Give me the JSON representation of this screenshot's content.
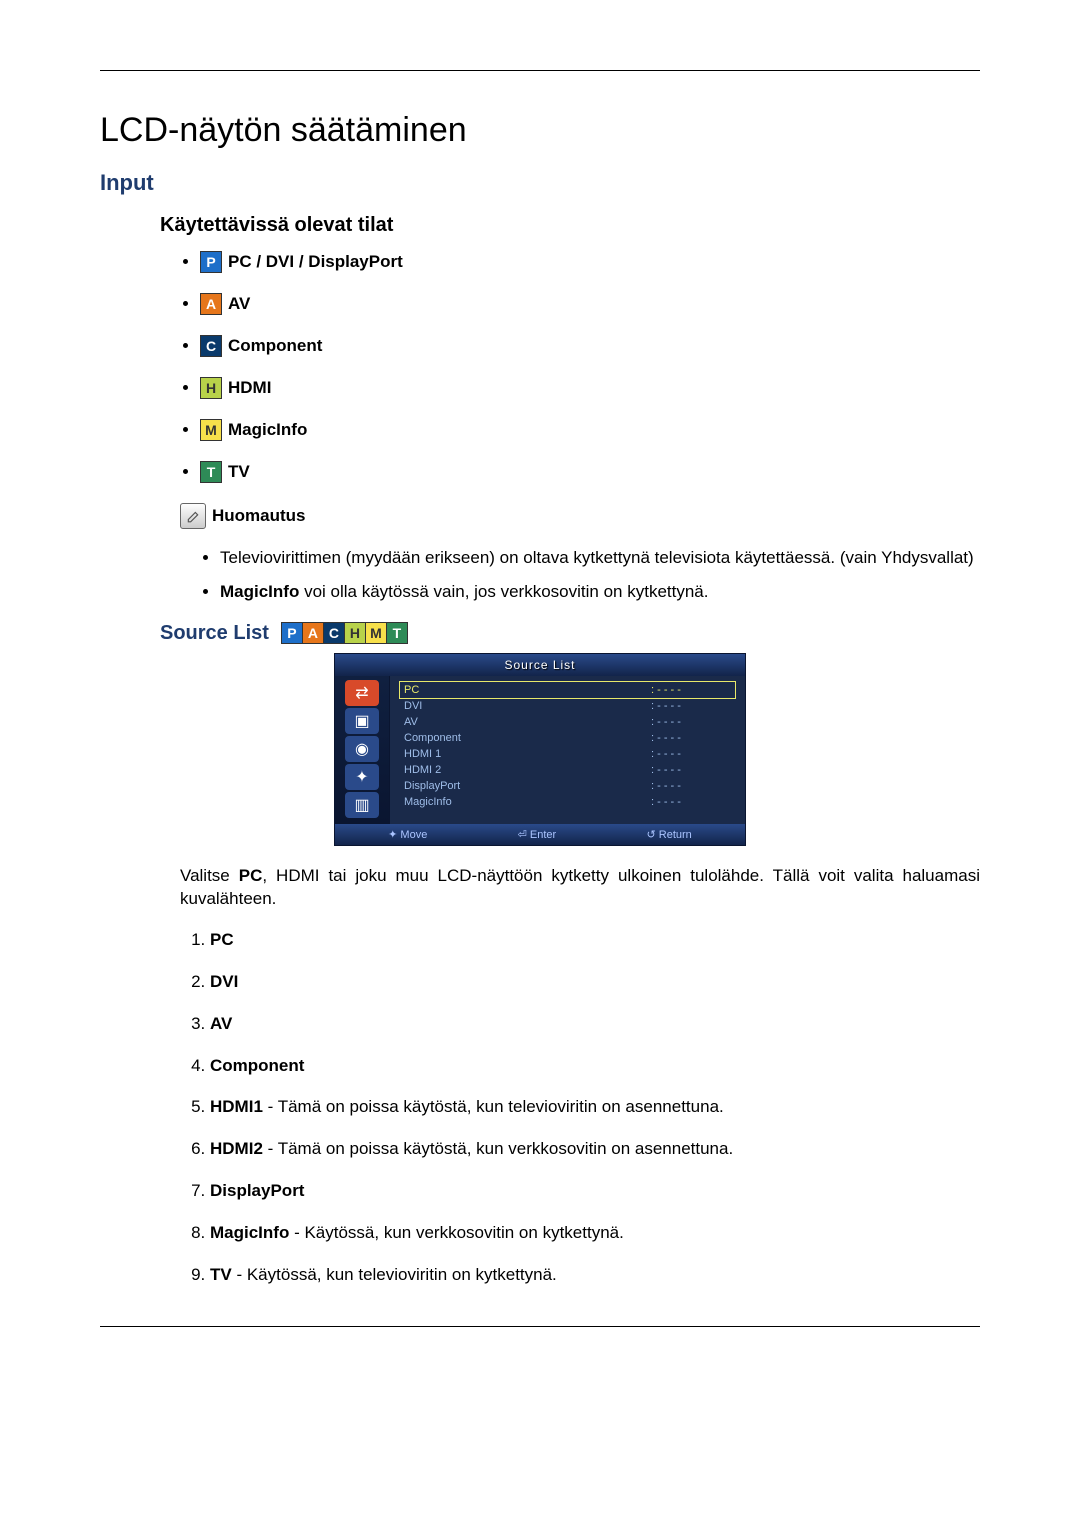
{
  "page": {
    "title": "LCD-näytön säätäminen",
    "input_heading": "Input",
    "modes_heading": "Käytettävissä olevat tilat",
    "modes": [
      {
        "icon": "P",
        "label": "PC / DVI / DisplayPort"
      },
      {
        "icon": "A",
        "label": "AV"
      },
      {
        "icon": "C",
        "label": "Component"
      },
      {
        "icon": "H",
        "label": "HDMI"
      },
      {
        "icon": "M",
        "label": "MagicInfo"
      },
      {
        "icon": "T",
        "label": "TV"
      }
    ],
    "note_label": "Huomautus",
    "note_items": {
      "item1": "Televiovirittimen (myydään erikseen) on oltava kytkettynä televisiota käytettäessä. (vain Yhdysvallat)",
      "item2_bold": "MagicInfo",
      "item2_rest": " voi olla käytössä vain, jos verkkosovitin on kytkettynä."
    },
    "source_list_heading": "Source List",
    "osd": {
      "title": "Source List",
      "rows": [
        {
          "name": "PC",
          "val": ": - - - -"
        },
        {
          "name": "DVI",
          "val": ": - - - -"
        },
        {
          "name": "AV",
          "val": ": - - - -"
        },
        {
          "name": "Component",
          "val": ": - - - -"
        },
        {
          "name": "HDMI 1",
          "val": ": - - - -"
        },
        {
          "name": "HDMI 2",
          "val": ": - - - -"
        },
        {
          "name": "DisplayPort",
          "val": ": - - - -"
        },
        {
          "name": "MagicInfo",
          "val": ": - - - -"
        }
      ],
      "footer": {
        "move": "Move",
        "enter": "Enter",
        "return": "Return"
      }
    },
    "body_para_pre": "Valitse ",
    "body_para_bold": "PC",
    "body_para_post": ", HDMI tai joku muu LCD-näyttöön kytketty ulkoinen tulolähde. Tällä voit valita haluamasi kuvalähteen.",
    "numbered": {
      "n1": "PC",
      "n2": "DVI",
      "n3": "AV",
      "n4": "Component",
      "n5_bold": "HDMI1",
      "n5_rest": " - Tämä on poissa käytöstä, kun televioviritin on asennettuna.",
      "n6_bold": "HDMI2",
      "n6_rest": " - Tämä on poissa käytöstä, kun verkkosovitin on asennettuna.",
      "n7": "DisplayPort",
      "n8_bold": "MagicInfo",
      "n8_rest": " - Käytössä, kun verkkosovitin on kytkettynä.",
      "n9_bold": "TV",
      "n9_rest": " - Käytössä, kun televioviritin on kytkettynä."
    }
  }
}
